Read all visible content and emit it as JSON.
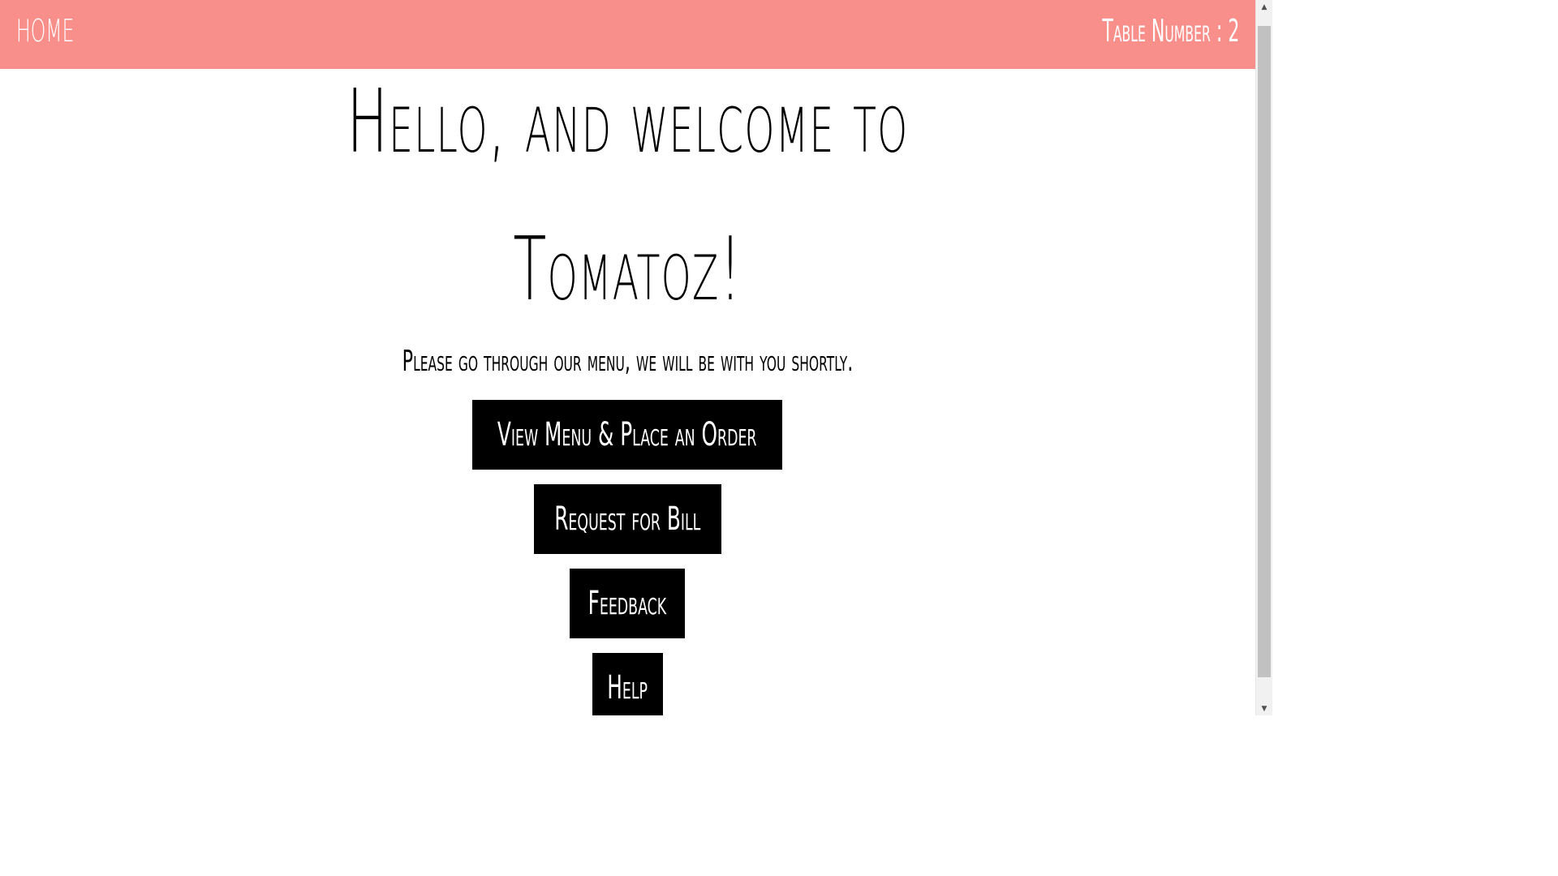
{
  "navbar": {
    "home_label": "HOME",
    "table_label": "Table Number : 2",
    "background_color": "#f98f8a",
    "text_color": "#ffffff"
  },
  "hero": {
    "title_line1": "Hello, and welcome to",
    "title_line2": "Tomatoz!",
    "subtitle": "Please go through our menu, we will be with you shortly."
  },
  "buttons": {
    "view_menu": "View Menu & Place an Order",
    "request_bill": "Request for Bill",
    "feedback": "Feedback",
    "help": "Help"
  },
  "scrollbar": {
    "up_icon": "triangle-up",
    "down_icon": "triangle-down"
  }
}
